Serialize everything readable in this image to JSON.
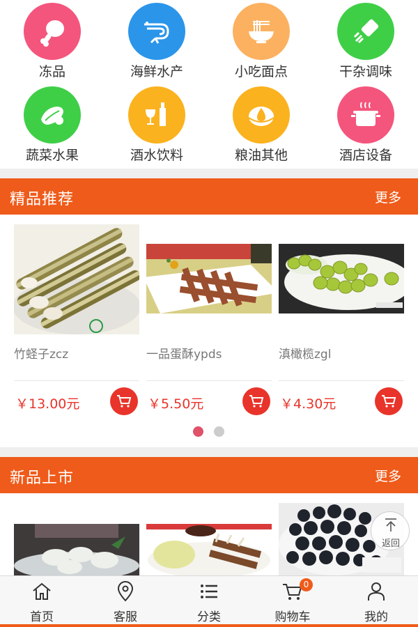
{
  "categories": [
    {
      "label": "冻品",
      "color": "#f4557d",
      "icon": "drumstick-icon"
    },
    {
      "label": "海鲜水产",
      "color": "#2b95ea",
      "icon": "shrimp-icon"
    },
    {
      "label": "小吃面点",
      "color": "#fcb160",
      "icon": "noodle-bowl-icon"
    },
    {
      "label": "干杂调味",
      "color": "#3fcf47",
      "icon": "seasoning-icon"
    },
    {
      "label": "蔬菜水果",
      "color": "#3fcf47",
      "icon": "vegetable-icon"
    },
    {
      "label": "酒水饮料",
      "color": "#fbb21f",
      "icon": "wine-icon"
    },
    {
      "label": "粮油其他",
      "color": "#fbb21f",
      "icon": "oil-drop-icon"
    },
    {
      "label": "酒店设备",
      "color": "#f4557d",
      "icon": "cooking-pot-icon"
    }
  ],
  "featured": {
    "title": "精品推荐",
    "more": "更多",
    "products": [
      {
        "name": "竹蛏子zcz",
        "price": "￥13.00元",
        "image": "razor-clam-photo"
      },
      {
        "name": "一品蛋酥ypds",
        "price": "￥5.50元",
        "image": "egg-pastry-photo"
      },
      {
        "name": "滇橄榄zgl",
        "price": "￥4.30元",
        "image": "olive-photo"
      }
    ],
    "pager": {
      "pages": 2,
      "active": 1
    }
  },
  "new_arrivals": {
    "title": "新品上市",
    "more": "更多",
    "products": [
      {
        "image": "clam-dish-photo"
      },
      {
        "image": "lamb-chop-photo"
      },
      {
        "image": "black-beans-photo"
      }
    ]
  },
  "back_to_top": {
    "label": "返回"
  },
  "tabbar": [
    {
      "label": "首页",
      "icon": "home-icon"
    },
    {
      "label": "客服",
      "icon": "location-pin-icon"
    },
    {
      "label": "分类",
      "icon": "list-icon"
    },
    {
      "label": "购物车",
      "icon": "cart-icon",
      "badge": "0"
    },
    {
      "label": "我的",
      "icon": "user-icon"
    }
  ],
  "colors": {
    "brand": "#ef5b1a",
    "price": "#e8342a",
    "pager_active": "#e0516a",
    "pager_inactive": "#cccccc"
  }
}
